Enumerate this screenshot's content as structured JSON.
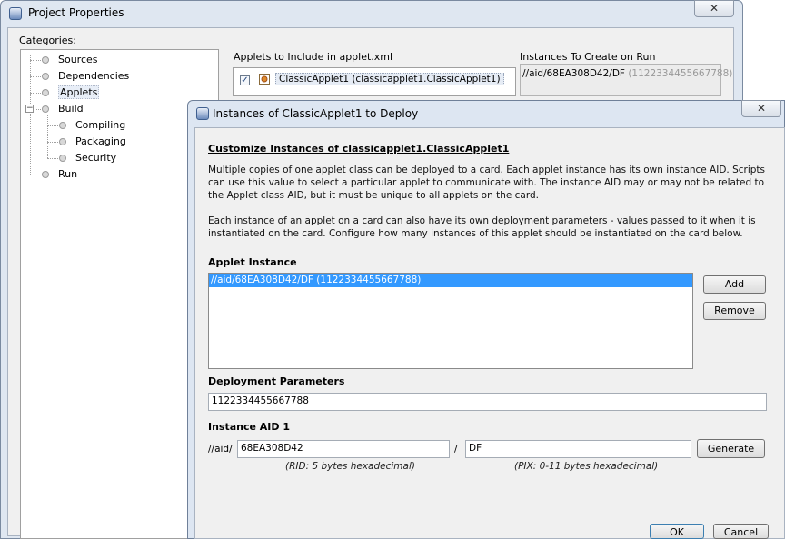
{
  "project_window": {
    "title": "Project Properties",
    "close_glyph": "✕",
    "categories_label": "Categories:",
    "categories": [
      {
        "label": "Sources",
        "level": 0
      },
      {
        "label": "Dependencies",
        "level": 0
      },
      {
        "label": "Applets",
        "level": 0,
        "selected": true
      },
      {
        "label": "Build",
        "level": 0,
        "expanded": true
      },
      {
        "label": "Compiling",
        "level": 1
      },
      {
        "label": "Packaging",
        "level": 1
      },
      {
        "label": "Security",
        "level": 1
      },
      {
        "label": "Run",
        "level": 0
      }
    ],
    "build_toggle": "−",
    "applets_label": "Applets to Include in applet.xml",
    "applet_item": "ClassicApplet1 (classicapplet1.ClassicApplet1)",
    "applet_checked": "✓",
    "instances_label": "Instances To Create on Run",
    "instance_aid": "//aid/68EA308D42/DF",
    "instance_params": "(1122334455667788)"
  },
  "dialog": {
    "title": "Instances of ClassicApplet1 to Deploy",
    "close_glyph": "✕",
    "heading": "Customize Instances of classicapplet1.ClassicApplet1",
    "paragraph1": "Multiple copies of one applet class can be deployed to a card.  Each applet instance has its own instance AID.  Scripts can use this value to select a particular applet to communicate with.  The instance AID may or may not be related to the Applet class AID, but it must be unique to all applets on the card.",
    "paragraph2": "Each instance of an applet on a card can also have its own deployment parameters - values passed to it when it is instantiated on the card.  Configure how many instances of this applet should be instantiated on the card below.",
    "applet_instance_label": "Applet Instance",
    "applet_instance_rows": [
      "//aid/68EA308D42/DF (1122334455667788)"
    ],
    "add_label": "Add",
    "remove_label": "Remove",
    "deployment_params_label": "Deployment Parameters",
    "deployment_params_value": "1122334455667788",
    "instance_aid_label": "Instance AID 1",
    "aid_prefix": "//aid/",
    "rid_value": "68EA308D42",
    "separator": "/",
    "pix_value": "DF",
    "generate_label": "Generate",
    "rid_hint": "(RID: 5 bytes hexadecimal)",
    "pix_hint": "(PIX: 0-11 bytes hexadecimal)",
    "ok_label": "OK",
    "cancel_label": "Cancel"
  },
  "colors": {
    "selection": "#3399ff",
    "titlebar": "#dfe7f1",
    "dialog_bg": "#f0f0f0"
  },
  "icons": [
    "window-icon",
    "close-icon",
    "tree-node-icon",
    "tree-collapse-icon",
    "checkbox-icon",
    "applet-icon"
  ]
}
